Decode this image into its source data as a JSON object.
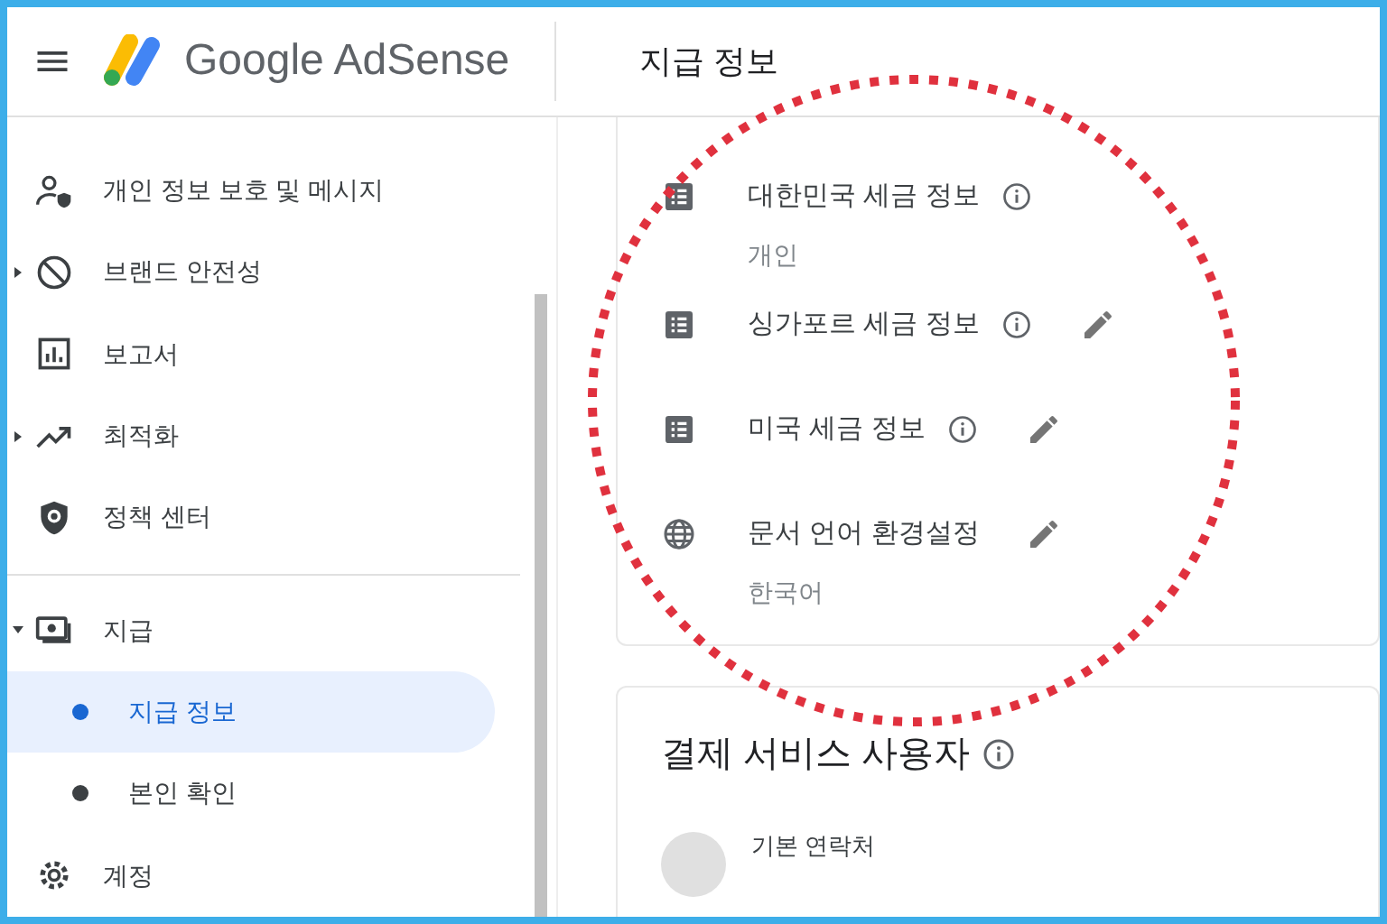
{
  "header": {
    "brand": "Google AdSense",
    "page_title": "지급 정보"
  },
  "sidebar": {
    "items": [
      {
        "label": "개인 정보 보호 및 메시지",
        "expandable": false
      },
      {
        "label": "브랜드 안전성",
        "expandable": true,
        "expanded": false
      },
      {
        "label": "보고서",
        "expandable": false
      },
      {
        "label": "최적화",
        "expandable": true,
        "expanded": false
      },
      {
        "label": "정책 센터",
        "expandable": false,
        "divider_after": true
      },
      {
        "label": "지급",
        "expandable": true,
        "expanded": true,
        "children": [
          {
            "label": "지급 정보",
            "selected": true
          },
          {
            "label": "본인 확인",
            "selected": false
          }
        ]
      },
      {
        "label": "계정",
        "expandable": false
      }
    ]
  },
  "settings_card": {
    "rows": [
      {
        "kind": "list",
        "label": "대한민국 세금 정보",
        "info": true,
        "editable": false,
        "value": "개인"
      },
      {
        "kind": "list",
        "label": "싱가포르 세금 정보",
        "info": true,
        "editable": true
      },
      {
        "kind": "list",
        "label": "미국 세금 정보",
        "info": true,
        "editable": true
      },
      {
        "kind": "globe",
        "label": "문서 언어 환경설정",
        "info": false,
        "editable": true,
        "value": "한국어"
      }
    ]
  },
  "payments_card": {
    "title": "결제 서비스 사용자",
    "contact_label": "기본 연락처"
  }
}
